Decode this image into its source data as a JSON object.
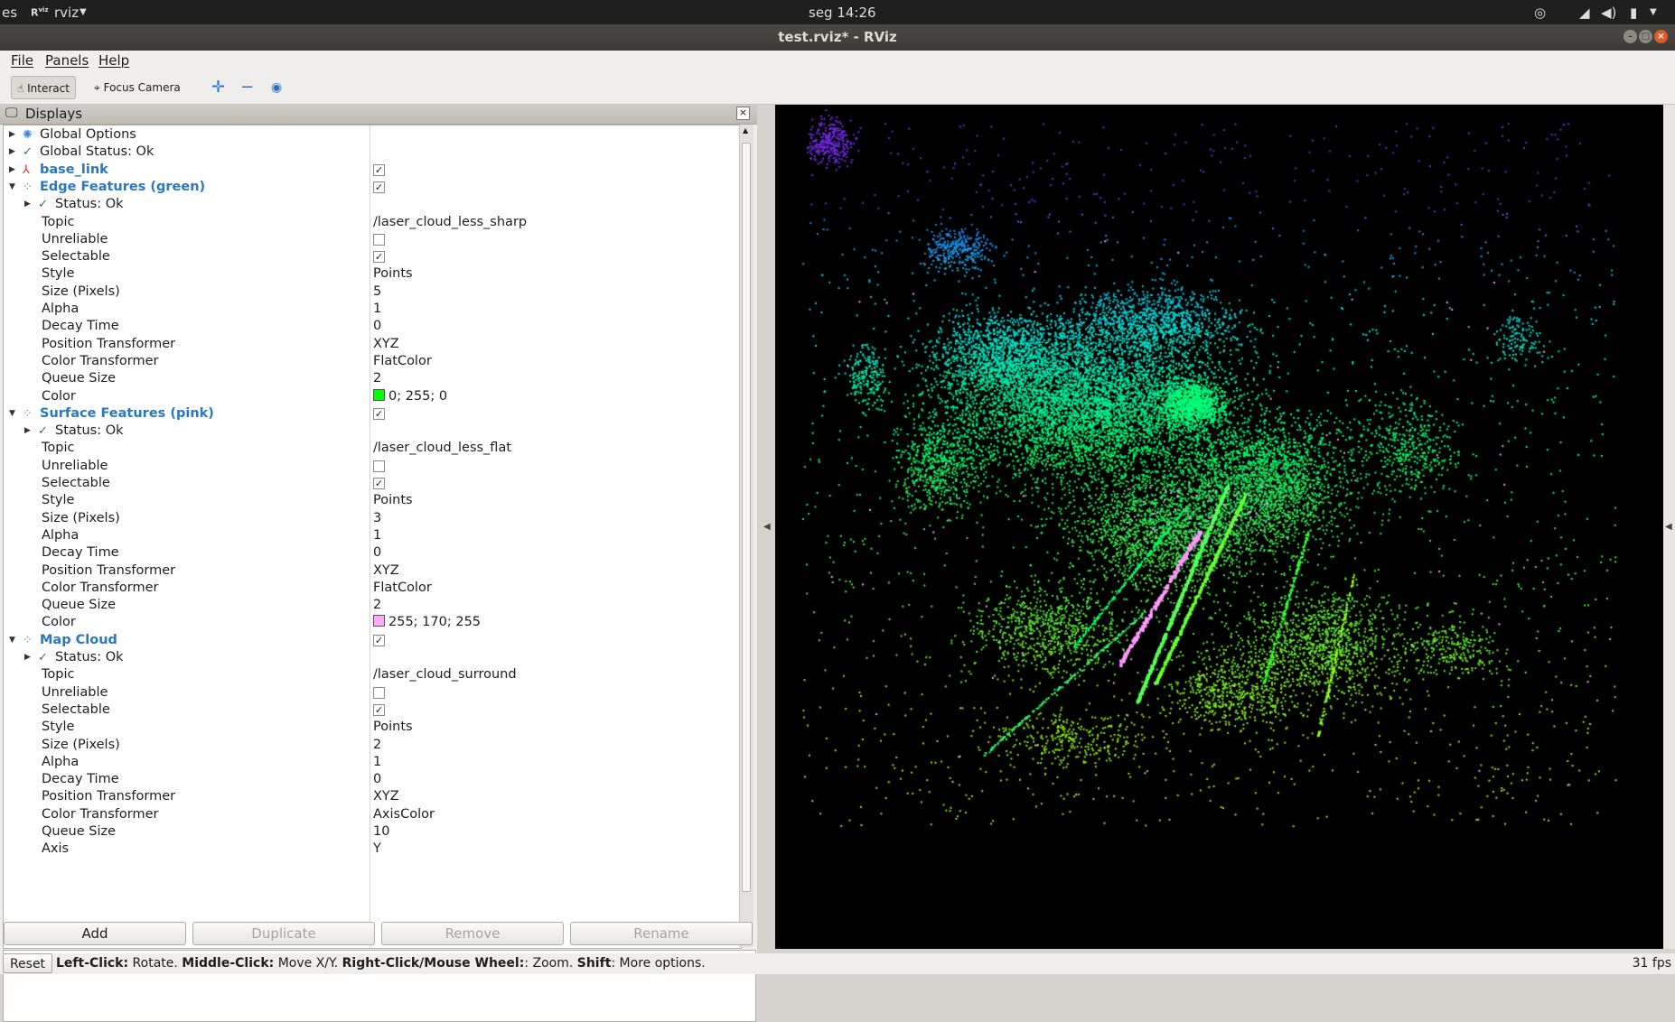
{
  "topbar": {
    "left_text": "es",
    "app_menu": "rviz",
    "clock": "seg 14:26"
  },
  "window": {
    "title": "test.rviz* - RViz"
  },
  "menu": {
    "file": "File",
    "panels": "Panels",
    "help": "Help"
  },
  "toolbar": {
    "interact": "Interact",
    "focus_camera": "Focus Camera"
  },
  "panel": {
    "title": "Displays"
  },
  "tree": [
    {
      "depth": 0,
      "arrow": "right",
      "icon": "gear-icon",
      "label": "Global Options",
      "style": "normal"
    },
    {
      "depth": 0,
      "arrow": "right",
      "icon": "check-icon",
      "label": "Global Status: Ok",
      "style": "normal"
    },
    {
      "depth": 0,
      "arrow": "right",
      "icon": "axes-icon",
      "label": "base_link",
      "style": "blue",
      "checkbox": true
    },
    {
      "depth": 0,
      "arrow": "down",
      "icon": "pointcloud-icon",
      "label": "Edge Features (green)",
      "style": "bluebold",
      "checkbox": true
    },
    {
      "depth": 1,
      "arrow": "right",
      "icon": "check-icon",
      "label": "Status: Ok",
      "style": "normal"
    },
    {
      "depth": 2,
      "label": "Topic",
      "value": "/laser_cloud_less_sharp"
    },
    {
      "depth": 2,
      "label": "Unreliable",
      "checkbox": false
    },
    {
      "depth": 2,
      "label": "Selectable",
      "checkbox": true
    },
    {
      "depth": 2,
      "label": "Style",
      "value": "Points"
    },
    {
      "depth": 2,
      "label": "Size (Pixels)",
      "value": "5"
    },
    {
      "depth": 2,
      "label": "Alpha",
      "value": "1"
    },
    {
      "depth": 2,
      "label": "Decay Time",
      "value": "0"
    },
    {
      "depth": 2,
      "label": "Position Transformer",
      "value": "XYZ"
    },
    {
      "depth": 2,
      "label": "Color Transformer",
      "value": "FlatColor"
    },
    {
      "depth": 2,
      "label": "Queue Size",
      "value": "2"
    },
    {
      "depth": 2,
      "label": "Color",
      "value": "0; 255; 0",
      "swatch": "#00ff00"
    },
    {
      "depth": 0,
      "arrow": "down",
      "icon": "pointcloud-icon",
      "label": "Surface Features (pink)",
      "style": "bluebold",
      "checkbox": true
    },
    {
      "depth": 1,
      "arrow": "right",
      "icon": "check-icon",
      "label": "Status: Ok",
      "style": "normal"
    },
    {
      "depth": 2,
      "label": "Topic",
      "value": "/laser_cloud_less_flat"
    },
    {
      "depth": 2,
      "label": "Unreliable",
      "checkbox": false
    },
    {
      "depth": 2,
      "label": "Selectable",
      "checkbox": true
    },
    {
      "depth": 2,
      "label": "Style",
      "value": "Points"
    },
    {
      "depth": 2,
      "label": "Size (Pixels)",
      "value": "3"
    },
    {
      "depth": 2,
      "label": "Alpha",
      "value": "1"
    },
    {
      "depth": 2,
      "label": "Decay Time",
      "value": "0"
    },
    {
      "depth": 2,
      "label": "Position Transformer",
      "value": "XYZ"
    },
    {
      "depth": 2,
      "label": "Color Transformer",
      "value": "FlatColor"
    },
    {
      "depth": 2,
      "label": "Queue Size",
      "value": "2"
    },
    {
      "depth": 2,
      "label": "Color",
      "value": "255; 170; 255",
      "swatch": "#ffaaff"
    },
    {
      "depth": 0,
      "arrow": "down",
      "icon": "pointcloud-icon",
      "label": "Map Cloud",
      "style": "bluebold",
      "checkbox": true
    },
    {
      "depth": 1,
      "arrow": "right",
      "icon": "check-icon",
      "label": "Status: Ok",
      "style": "normal"
    },
    {
      "depth": 2,
      "label": "Topic",
      "value": "/laser_cloud_surround"
    },
    {
      "depth": 2,
      "label": "Unreliable",
      "checkbox": false
    },
    {
      "depth": 2,
      "label": "Selectable",
      "checkbox": true
    },
    {
      "depth": 2,
      "label": "Style",
      "value": "Points"
    },
    {
      "depth": 2,
      "label": "Size (Pixels)",
      "value": "2"
    },
    {
      "depth": 2,
      "label": "Alpha",
      "value": "1"
    },
    {
      "depth": 2,
      "label": "Decay Time",
      "value": "0"
    },
    {
      "depth": 2,
      "label": "Position Transformer",
      "value": "XYZ"
    },
    {
      "depth": 2,
      "label": "Color Transformer",
      "value": "AxisColor"
    },
    {
      "depth": 2,
      "label": "Queue Size",
      "value": "10"
    },
    {
      "depth": 2,
      "label": "Axis",
      "value": "Y"
    }
  ],
  "buttons": {
    "add": "Add",
    "duplicate": "Duplicate",
    "remove": "Remove",
    "rename": "Rename"
  },
  "status": {
    "reset": "Reset",
    "hint_parts": [
      {
        "b": "Left-Click:",
        "t": " Rotate. "
      },
      {
        "b": "Middle-Click:",
        "t": " Move X/Y. "
      },
      {
        "b": "Right-Click/Mouse Wheel:",
        "t": ": Zoom. "
      },
      {
        "b": "Shift",
        "t": ": More options."
      }
    ],
    "fps": "31 fps"
  },
  "colors": {
    "edge": "#00ff00",
    "surface": "#ffaaff",
    "viewport_bg": "#000000"
  }
}
